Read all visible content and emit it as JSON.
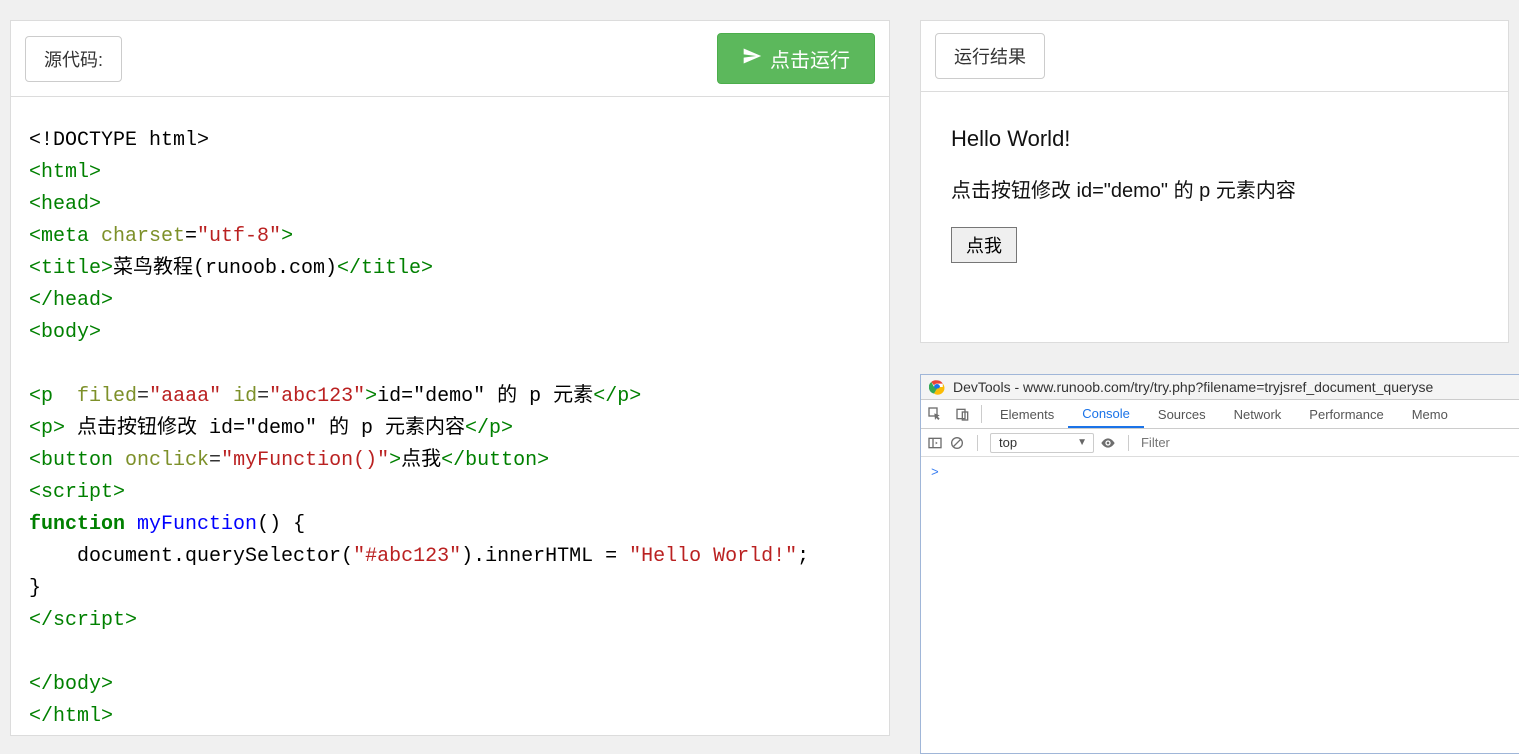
{
  "leftPanel": {
    "sourceLabel": "源代码:",
    "runLabel": "点击运行"
  },
  "code": {
    "l1_pre": "<!DOCTYPE html>",
    "l2_open": "<html>",
    "l3_open": "<head>",
    "l4_tag_open": "<meta",
    "l4_attr1": " charset",
    "l4_eq": "=",
    "l4_val1": "\"utf-8\"",
    "l4_close": ">",
    "l5_topen": "<title>",
    "l5_text": "菜鸟教程(runoob.com)",
    "l5_tclose": "</title>",
    "l6": "</head>",
    "l7": "<body>",
    "l8_p1_open": "<p",
    "l8_sp": "  ",
    "l8_attr1": "filed",
    "l8_eq1": "=",
    "l8_val1": "\"aaaa\"",
    "l8_sp2": " ",
    "l8_attr2": "id",
    "l8_eq2": "=",
    "l8_val2": "\"abc123\"",
    "l8_gt": ">",
    "l8_text": "id=\"demo\" 的 p 元素",
    "l8_close": "</p>",
    "l9_open": "<p>",
    "l9_text": " 点击按钮修改 id=\"demo\" 的 p 元素内容",
    "l9_close": "</p>",
    "l10_open": "<button",
    "l10_sp": " ",
    "l10_attr": "onclick",
    "l10_eq": "=",
    "l10_val": "\"myFunction()\"",
    "l10_gt": ">",
    "l10_text": "点我",
    "l10_close": "</button>",
    "l11": "<script>",
    "l12_kw": "function",
    "l12_sp": " ",
    "l12_name": "myFunction",
    "l12_rest": "() {",
    "l13_indent": "    ",
    "l13_body1": "document.querySelector(",
    "l13_str": "\"#abc123\"",
    "l13_body2": ").innerHTML = ",
    "l13_str2": "\"Hello World!\"",
    "l13_semi": ";",
    "l14": "}",
    "l15": "</scr",
    "l15b": "ipt>",
    "l16": "</body>",
    "l17": "</html>"
  },
  "rightPanel": {
    "resultLabel": "运行结果",
    "heading": "Hello World!",
    "paragraph": "点击按钮修改 id=\"demo\" 的 p 元素内容",
    "buttonLabel": "点我"
  },
  "devtools": {
    "title": "DevTools - www.runoob.com/try/try.php?filename=tryjsref_document_queryse",
    "tabs": {
      "elements": "Elements",
      "console": "Console",
      "sources": "Sources",
      "network": "Network",
      "performance": "Performance",
      "memory": "Memo"
    },
    "context": "top",
    "filterPlaceholder": "Filter",
    "prompt": ">"
  }
}
